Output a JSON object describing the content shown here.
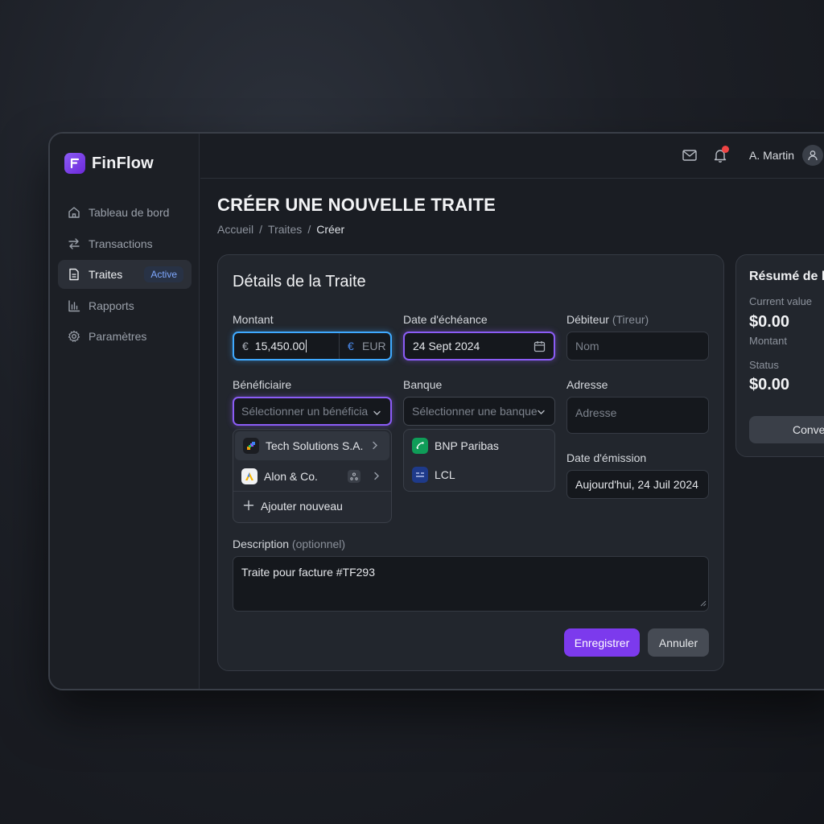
{
  "app": {
    "name": "FinFlow"
  },
  "sidebar": {
    "items": [
      {
        "label": "Tableau de bord",
        "icon": "home-icon"
      },
      {
        "label": "Transactions",
        "icon": "arrows-swap-icon"
      },
      {
        "label": "Traites",
        "icon": "document-icon",
        "badge": "Active"
      },
      {
        "label": "Rapports",
        "icon": "bar-chart-icon"
      },
      {
        "label": "Paramètres",
        "icon": "gear-icon"
      }
    ]
  },
  "header": {
    "user_name": "A. Martin"
  },
  "page": {
    "title": "CRÉER UNE NOUVELLE TRAITE",
    "breadcrumb": [
      "Accueil",
      "/",
      "Traites",
      "/",
      "Créer"
    ]
  },
  "form": {
    "title": "Détails de la Traite",
    "montant": {
      "label": "Montant",
      "currency_symbol": "€",
      "value": "15,450.00",
      "currency": "EUR"
    },
    "echeance": {
      "label": "Date d'échéance",
      "value": "24 Sept 2024"
    },
    "debiteur": {
      "label": "Débiteur",
      "label_muted": "(Tireur)",
      "placeholder": "Nom"
    },
    "beneficiaire": {
      "label": "Bénéficiaire",
      "placeholder": "Sélectionner un bénéficiair",
      "options": [
        "Tech Solutions S.A.",
        "Alon & Co.",
        "Ajouter nouveau"
      ]
    },
    "banque": {
      "label": "Banque",
      "placeholder": "Sélectionner une banque",
      "options": [
        "BNP Paribas",
        "LCL"
      ]
    },
    "adresse": {
      "label": "Adresse",
      "placeholder": "Adresse"
    },
    "emission": {
      "label": "Date d'émission",
      "value": "Aujourd'hui, 24 Juil 2024"
    },
    "description": {
      "label": "Description",
      "label_muted": "(optionnel)",
      "value": "Traite pour facture #TF293"
    },
    "save_label": "Enregistrer",
    "cancel_label": "Annuler"
  },
  "summary": {
    "title": "Résumé de la",
    "current_value_label": "Current value",
    "current_value": "$0.00",
    "montant_label": "Montant",
    "status_label": "Status",
    "status_value": "$0.00",
    "button_label": "Convert"
  },
  "colors": {
    "accent": "#7c3aed",
    "focus_blue": "#3fa9ff",
    "notification": "#ef4444"
  }
}
